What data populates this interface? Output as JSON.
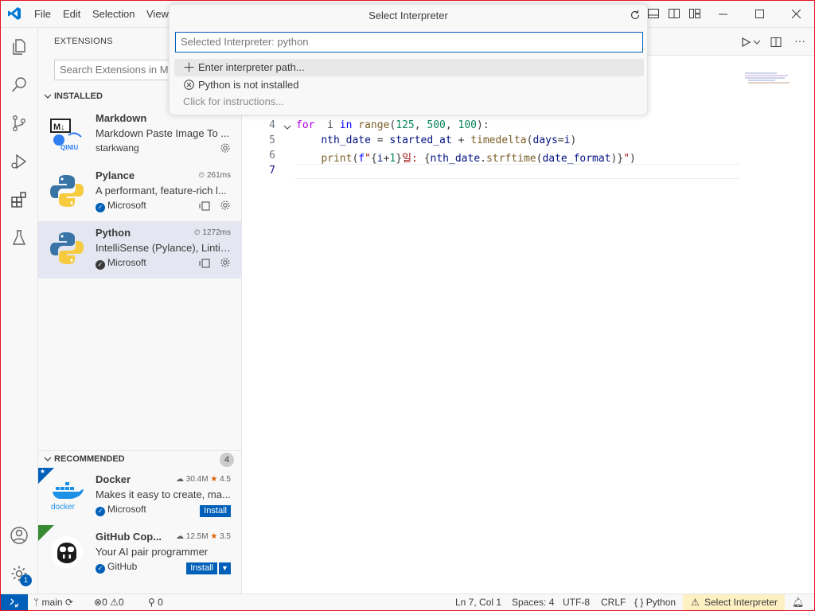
{
  "menu": [
    "File",
    "Edit",
    "Selection",
    "View"
  ],
  "sidebar": {
    "title": "EXTENSIONS",
    "search_placeholder": "Search Extensions in Ma",
    "installed_header": "INSTALLED",
    "installed": [
      {
        "name": "Markdown",
        "desc": "Markdown Paste Image To ...",
        "publisher": "starkwang",
        "verified": false,
        "meta": ""
      },
      {
        "name": "Pylance",
        "desc": "A performant, feature-rich l...",
        "publisher": "Microsoft",
        "verified": true,
        "meta": "261ms"
      },
      {
        "name": "Python",
        "desc": "IntelliSense (Pylance), Lintin...",
        "publisher": "Microsoft",
        "verified": true,
        "meta": "1272ms"
      }
    ],
    "recommended_header": "RECOMMENDED",
    "recommended_count": "4",
    "recommended": [
      {
        "name": "Docker",
        "desc": "Makes it easy to create, ma...",
        "publisher": "Microsoft",
        "downloads": "30.4M",
        "rating": "4.5",
        "install_label": "Install"
      },
      {
        "name": "GitHub Cop...",
        "desc": "Your AI pair programmer",
        "publisher": "GitHub",
        "downloads": "12.5M",
        "rating": "3.5",
        "install_label": "Install"
      }
    ],
    "markdown_icon_text": "QINIU"
  },
  "activity": {
    "accounts_badge": "1"
  },
  "quickpick": {
    "title": "Select Interpreter",
    "input_placeholder": "Selected Interpreter: python",
    "items": [
      {
        "label": "Enter interpreter path...",
        "icon": "plus-icon"
      },
      {
        "label": "Python is not installed",
        "icon": "error-circle-icon"
      }
    ],
    "hint": "Click for instructions..."
  },
  "editor": {
    "lines": [
      {
        "num": "4",
        "tokens": [
          [
            "kw",
            "for"
          ],
          [
            "",
            "  i "
          ],
          [
            "kw2",
            "in"
          ],
          [
            "",
            ""
          ],
          [
            "fn",
            " range"
          ],
          [
            "",
            "("
          ],
          [
            "num",
            "125"
          ],
          [
            "",
            ", "
          ],
          [
            "num",
            "500"
          ],
          [
            "",
            ", "
          ],
          [
            "num",
            "100"
          ],
          [
            "",
            "):"
          ]
        ]
      },
      {
        "num": "5",
        "tokens": [
          [
            "",
            "    "
          ],
          [
            "vr",
            "nth_date"
          ],
          [
            "",
            " = "
          ],
          [
            "vr",
            "started_at"
          ],
          [
            "",
            " + "
          ],
          [
            "fn",
            "timedelta"
          ],
          [
            "",
            "("
          ],
          [
            "vr",
            "days"
          ],
          [
            "",
            "="
          ],
          [
            "vr",
            "i"
          ],
          [
            "",
            ")"
          ]
        ]
      },
      {
        "num": "6",
        "tokens": [
          [
            "",
            "    "
          ],
          [
            "fn",
            "print"
          ],
          [
            "",
            "("
          ],
          [
            "kw2",
            "f"
          ],
          [
            "str",
            "\""
          ],
          [
            "",
            "{"
          ],
          [
            "vr",
            "i"
          ],
          [
            "",
            "+"
          ],
          [
            "num",
            "1"
          ],
          [
            "",
            "}"
          ],
          [
            "str",
            "일: "
          ],
          [
            "",
            "{"
          ],
          [
            "vr",
            "nth_date"
          ],
          [
            "",
            "."
          ],
          [
            "fn",
            "strftime"
          ],
          [
            "",
            "("
          ],
          [
            "vr",
            "date_format"
          ],
          [
            "",
            ")}"
          ],
          [
            "str",
            "\""
          ],
          [
            "",
            ")"
          ]
        ]
      },
      {
        "num": "7",
        "tokens": []
      }
    ]
  },
  "status": {
    "branch": "main",
    "errors": "0",
    "warnings": "0",
    "ports": "0",
    "position": "Ln 7, Col 1",
    "spaces": "Spaces: 4",
    "encoding": "UTF-8",
    "eol": "CRLF",
    "language": "Python",
    "interpreter": "Select Interpreter"
  }
}
